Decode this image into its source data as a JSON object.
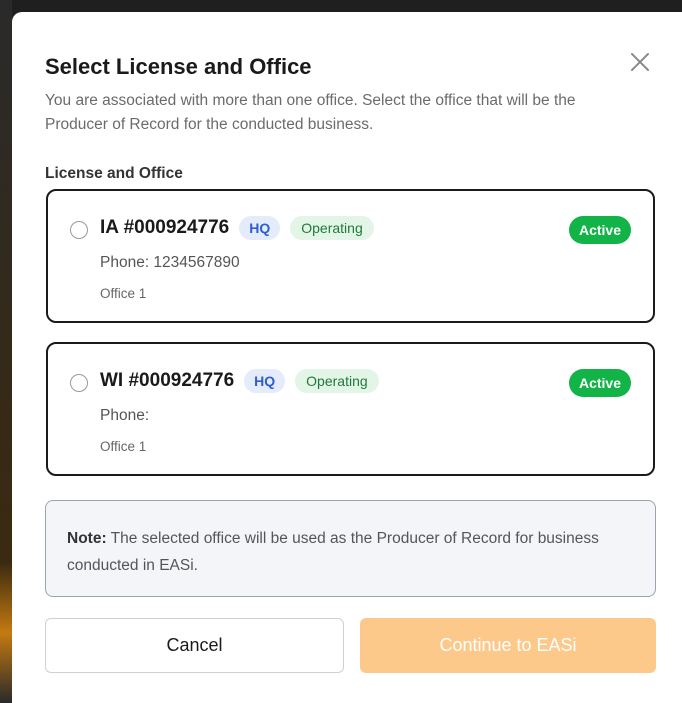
{
  "modal": {
    "title": "Select License and Office",
    "description": "You are associated with more than one office. Select the office that will be the Producer of Record for the conducted business.",
    "close_icon": "close-icon"
  },
  "section_label": "License and Office",
  "offices": [
    {
      "license": "IA #000924776",
      "hq_badge": "HQ",
      "operating_badge": "Operating",
      "status": "Active",
      "phone": "Phone: 1234567890",
      "office": "Office 1",
      "selected": false
    },
    {
      "license": "WI #000924776",
      "hq_badge": "HQ",
      "operating_badge": "Operating",
      "status": "Active",
      "phone": "Phone:",
      "office": "Office 1",
      "selected": false
    }
  ],
  "note": {
    "label": "Note:",
    "text": " The selected office will be used as the Producer of Record for business conducted in EASi."
  },
  "buttons": {
    "cancel": "Cancel",
    "continue": "Continue to EASi"
  },
  "colors": {
    "active_badge": "#12b347",
    "hq_text": "#2f5dcf",
    "operating_text": "#1f7a3a",
    "continue_disabled": "#fdc98a"
  }
}
